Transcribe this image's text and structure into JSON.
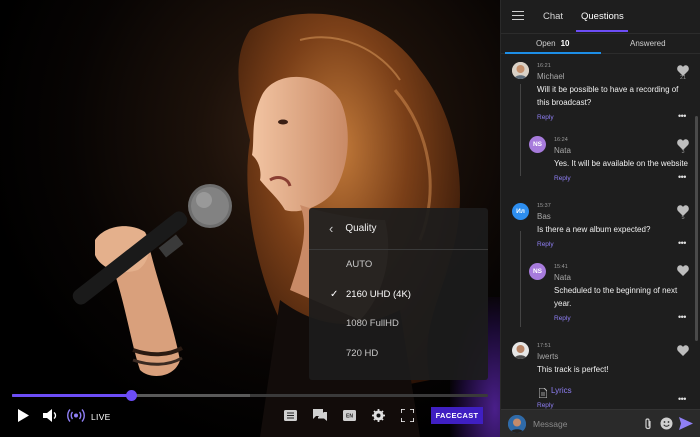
{
  "player": {
    "progress_fraction": 0.25,
    "buffered_fraction": 0.5,
    "live_label": "LIVE",
    "brand": "FACECAST",
    "quality_menu": {
      "title": "Quality",
      "options": [
        "AUTO",
        "2160 UHD (4K)",
        "1080 FullHD",
        "720 HD"
      ],
      "selected": "2160 UHD (4K)"
    },
    "controls_icons": [
      "play-icon",
      "volume-icon",
      "broadcast-icon",
      "list-icon",
      "chat-icon",
      "subtitles-icon",
      "settings-icon",
      "fullscreen-icon"
    ],
    "subtitles_badge": "EN"
  },
  "sidebar": {
    "tabs": [
      "Chat",
      "Questions"
    ],
    "active_tab": "Questions",
    "subtabs": {
      "open_label": "Open",
      "open_count": "10",
      "answered_label": "Answered"
    },
    "messages": [
      {
        "time": "16:21",
        "name": "Michael",
        "text_lines": [
          "Will it be possible to have a recording of",
          "this broadcast?"
        ],
        "reply": "Reply",
        "likes": "21",
        "avatar": "photo"
      },
      {
        "time": "16:24",
        "name": "Nata",
        "initials": "NS",
        "text_lines": [
          "Yes. It will be available on the website"
        ],
        "reply": "Reply",
        "likes": "3"
      },
      {
        "time": "15:37",
        "name": "Bas",
        "initials": "Ил",
        "text_lines": [
          "Is there a new album expected?"
        ],
        "reply": "Reply",
        "likes": "5"
      },
      {
        "time": "15:41",
        "name": "Nata",
        "initials": "NS",
        "text_lines": [
          "Scheduled to the beginning of next",
          "year."
        ],
        "reply": "Reply"
      },
      {
        "time": "17:51",
        "name": "Iwerts",
        "text_lines": [
          "This track is perfect!"
        ],
        "attachment": "Lyrics",
        "reply": "Reply",
        "avatar": "photo"
      }
    ],
    "input_placeholder": "Message"
  },
  "colors": {
    "accent": "#6c4df6",
    "brand": "#3f1fc2",
    "tab_underline": "#1d8ee6",
    "reply": "#8f7ff5",
    "ns_avatar": "#a77bdc",
    "il_avatar": "#2d8ef0"
  }
}
